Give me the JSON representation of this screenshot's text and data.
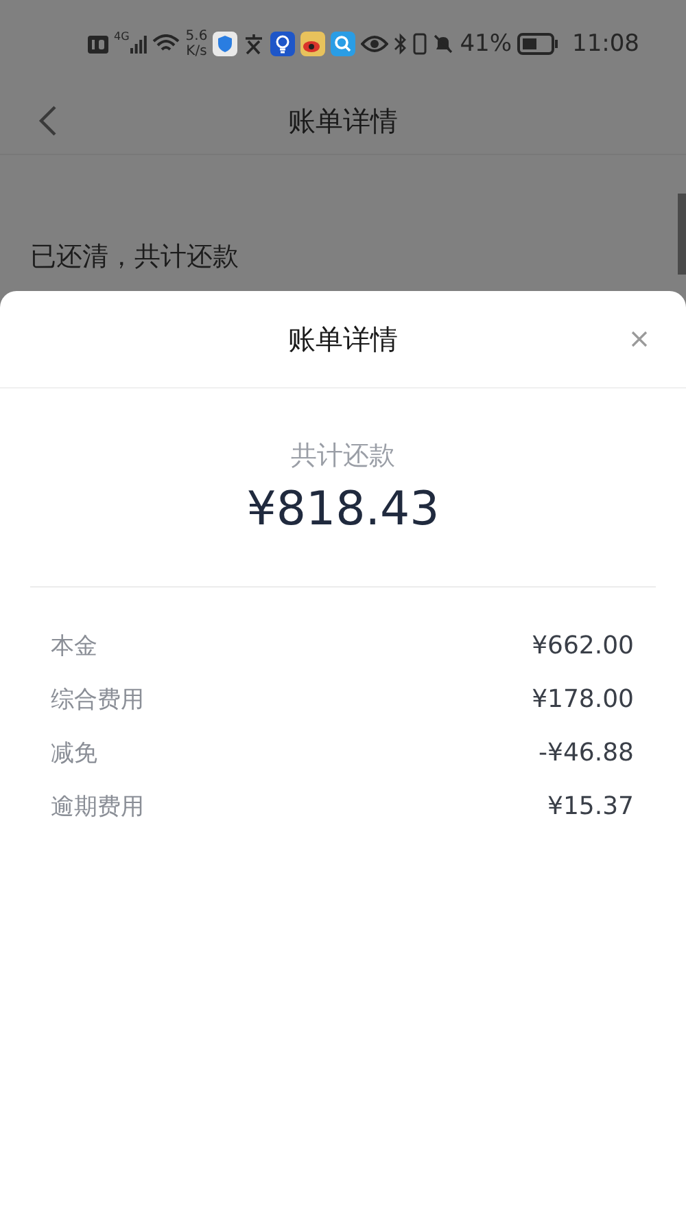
{
  "status_bar": {
    "network_type": "4G",
    "speed_value": "5.6",
    "speed_unit": "K/s",
    "battery": "41%",
    "time": "11:08"
  },
  "header": {
    "title": "账单详情"
  },
  "page": {
    "summary_label": "已还清，共计还款"
  },
  "sheet": {
    "title": "账单详情",
    "total_label": "共计还款",
    "total_amount": "¥818.43",
    "items": [
      {
        "label": "本金",
        "value": "¥662.00"
      },
      {
        "label": "综合费用",
        "value": "¥178.00"
      },
      {
        "label": "减免",
        "value": "-¥46.88"
      },
      {
        "label": "逾期费用",
        "value": "¥15.37"
      }
    ]
  }
}
